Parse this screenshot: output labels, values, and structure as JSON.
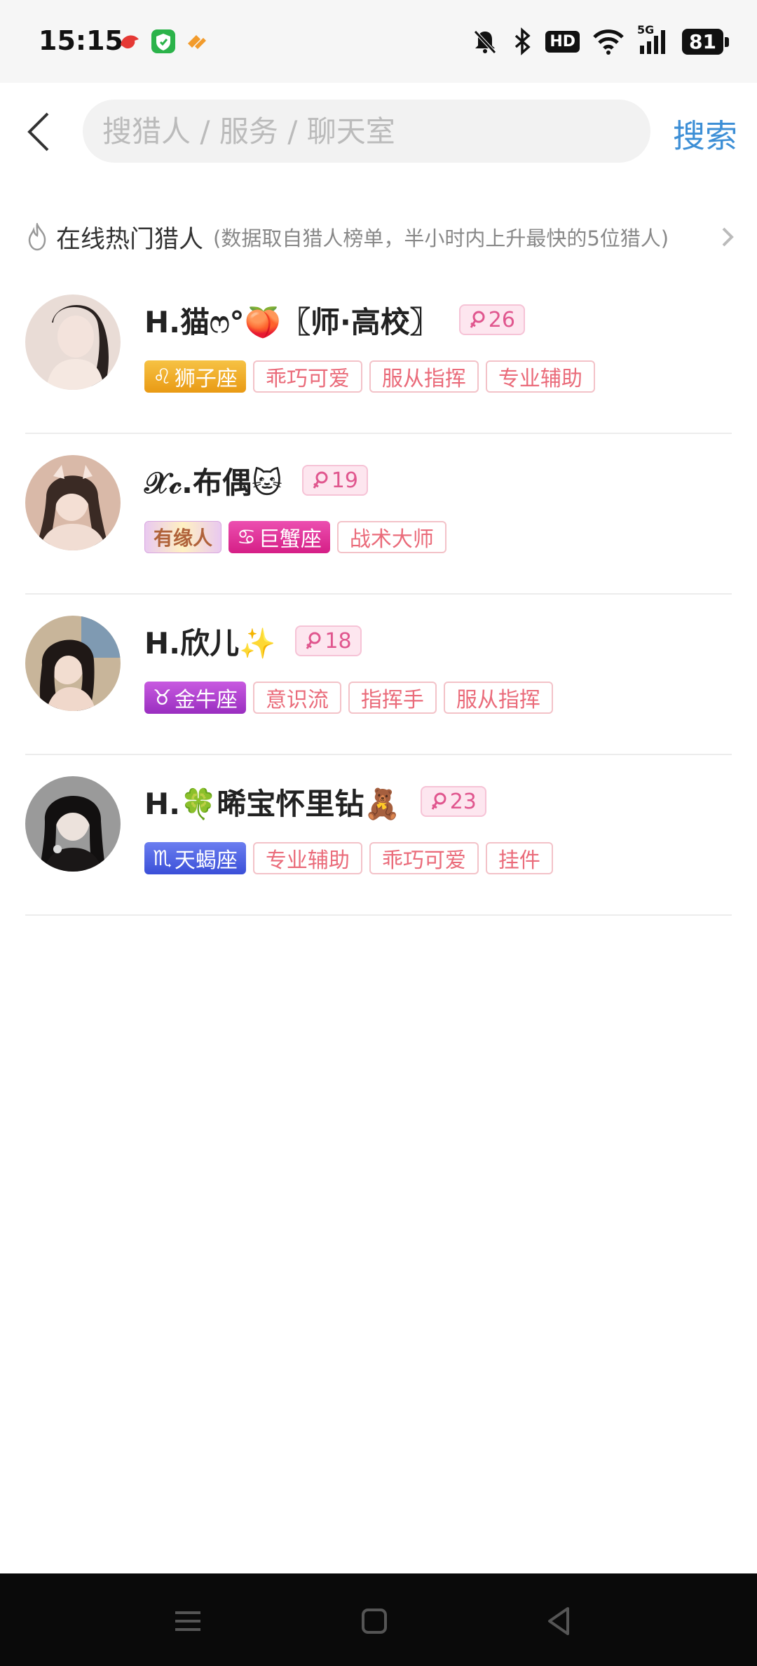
{
  "status_bar": {
    "time": "15:15",
    "hd": "HD",
    "network": "5G",
    "battery": "81"
  },
  "header": {
    "search_placeholder": "搜猎人 / 服务 / 聊天室",
    "search_label": "搜索"
  },
  "section": {
    "title": "在线热门猎人",
    "note": "(数据取自猎人榜单，半小时内上升最快的5位猎人)"
  },
  "hunters": [
    {
      "name": "H.猫ෆ°🍑〖师·高校〗",
      "level": "26",
      "fate_tag": "",
      "zodiac": {
        "symbol": "♌",
        "label": "狮子座",
        "color": "#f0a321"
      },
      "tags": [
        "乖巧可爱",
        "服从指挥",
        "专业辅助"
      ]
    },
    {
      "name": "𝒳𝒸.布偶🐱",
      "level": "19",
      "fate_tag": "有缘人",
      "zodiac": {
        "symbol": "♋",
        "label": "巨蟹座",
        "color": "#e2359c"
      },
      "tags": [
        "战术大师"
      ]
    },
    {
      "name": "H.欣儿✨",
      "level": "18",
      "fate_tag": "",
      "zodiac": {
        "symbol": "♉",
        "label": "金牛座",
        "color": "#b43fd2"
      },
      "tags": [
        "意识流",
        "指挥手",
        "服从指挥"
      ]
    },
    {
      "name": "H.🍀晞宝怀里钻🧸",
      "level": "23",
      "fate_tag": "",
      "zodiac": {
        "symbol": "♏",
        "label": "天蝎座",
        "color": "#4f63e6"
      },
      "tags": [
        "专业辅助",
        "乖巧可爱",
        "挂件"
      ]
    }
  ]
}
